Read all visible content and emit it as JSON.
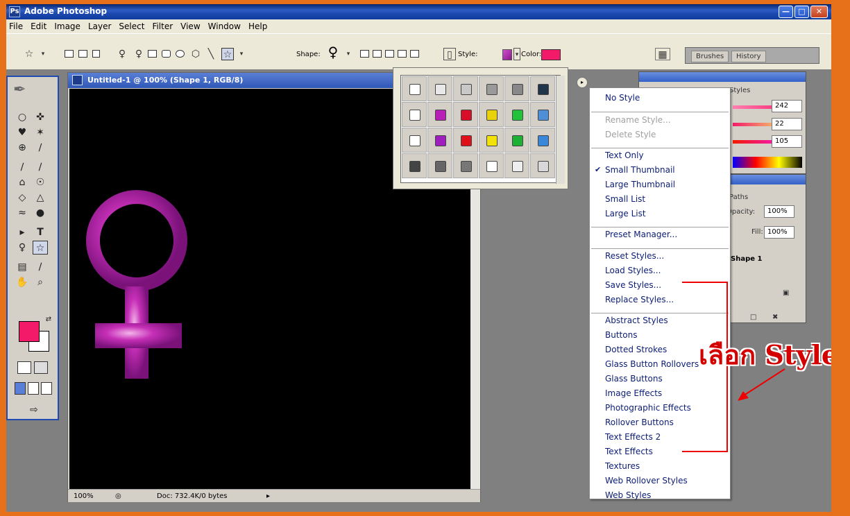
{
  "app": {
    "title": "Adobe Photoshop"
  },
  "window_buttons": {
    "minimize": "—",
    "maximize": "□",
    "close": "✕"
  },
  "menubar": [
    "File",
    "Edit",
    "Image",
    "Layer",
    "Select",
    "Filter",
    "View",
    "Window",
    "Help"
  ],
  "options_bar": {
    "shape_label": "Shape:",
    "shape_glyph": "♀",
    "style_label": "Style:",
    "color_label": "Color:",
    "color_value": "#f41a6a",
    "well_tabs": [
      "Brushes",
      "History"
    ]
  },
  "document": {
    "title": "Untitled-1 @ 100% (Shape 1, RGB/8)",
    "zoom": "100%",
    "doc_info": "Doc: 732.4K/0 bytes",
    "shape_glyph": "♀",
    "shape_color": "#c62fb7"
  },
  "color_panel": {
    "tab": "Styles",
    "values": [
      "242",
      "22",
      "105"
    ]
  },
  "layers_panel": {
    "tab": "Paths",
    "opacity_label": "Opacity:",
    "opacity": "100%",
    "fill_label": "Fill:",
    "fill": "100%",
    "layer_name": "Shape 1"
  },
  "styles_menu": {
    "items": [
      {
        "label": "No Style",
        "state": "normal"
      },
      {
        "label": "Rename Style...",
        "state": "disabled"
      },
      {
        "label": "Delete Style",
        "state": "disabled"
      },
      {
        "label": "Text Only",
        "state": "normal"
      },
      {
        "label": "Small Thumbnail",
        "state": "checked"
      },
      {
        "label": "Large Thumbnail",
        "state": "normal"
      },
      {
        "label": "Small List",
        "state": "normal"
      },
      {
        "label": "Large List",
        "state": "normal"
      },
      {
        "label": "Preset Manager...",
        "state": "normal"
      },
      {
        "label": "Reset Styles...",
        "state": "normal"
      },
      {
        "label": "Load Styles...",
        "state": "normal"
      },
      {
        "label": "Save Styles...",
        "state": "normal"
      },
      {
        "label": "Replace Styles...",
        "state": "normal"
      },
      {
        "label": "Abstract Styles",
        "state": "normal"
      },
      {
        "label": "Buttons",
        "state": "normal"
      },
      {
        "label": "Dotted Strokes",
        "state": "normal"
      },
      {
        "label": "Glass Button Rollovers",
        "state": "normal"
      },
      {
        "label": "Glass Buttons",
        "state": "normal"
      },
      {
        "label": "Image Effects",
        "state": "normal"
      },
      {
        "label": "Photographic Effects",
        "state": "normal"
      },
      {
        "label": "Rollover Buttons",
        "state": "normal"
      },
      {
        "label": "Text Effects 2",
        "state": "normal"
      },
      {
        "label": "Text Effects",
        "state": "normal"
      },
      {
        "label": "Textures",
        "state": "normal"
      },
      {
        "label": "Web Rollover Styles",
        "state": "normal"
      },
      {
        "label": "Web Styles",
        "state": "normal"
      }
    ],
    "check_glyph": "✔"
  },
  "style_swatches": [
    [
      "#ffffff",
      "#e8e8e8",
      "#c8c8c8",
      "#9a9a9a",
      "#888888",
      "#20344a"
    ],
    [
      "#ffffff",
      "#b71fb7",
      "#d90f2a",
      "#e7d20b",
      "#22c23a",
      "#4e8fd6"
    ],
    [
      "#ffffff",
      "#9e1fbd",
      "#e0101a",
      "#f3e20a",
      "#1cb132",
      "#3a86d8"
    ],
    [
      "#444444",
      "#666666",
      "#777777",
      "#ffffff",
      "#eeeeee",
      "#d8d8d8"
    ]
  ],
  "annotation": {
    "text": "เลือก Style",
    "color": "#d40000"
  }
}
